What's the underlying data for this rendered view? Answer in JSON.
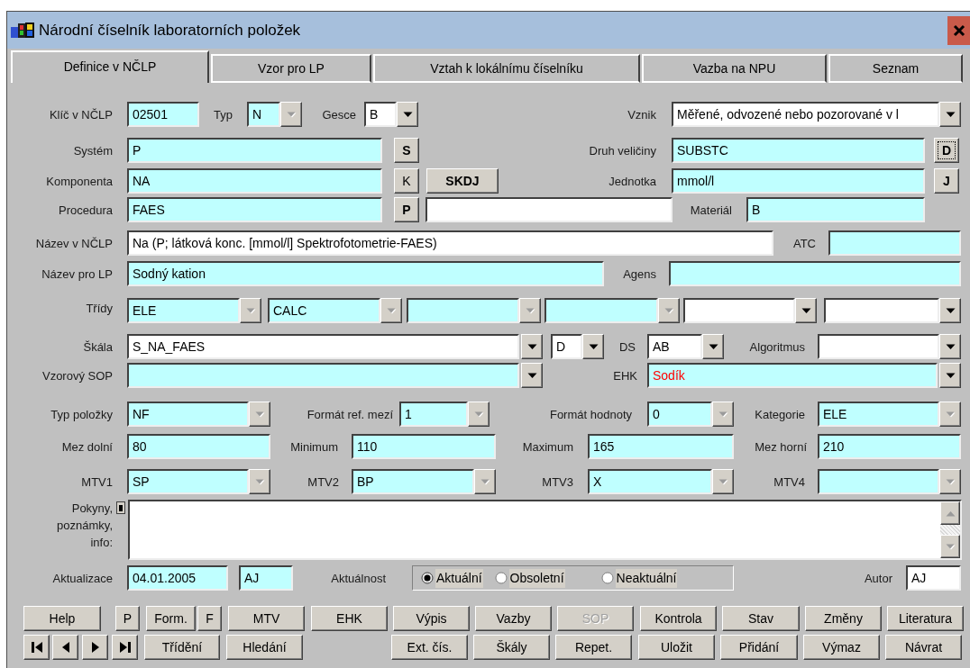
{
  "window": {
    "title": "Národní číselník laboratorních položek"
  },
  "tabs": [
    {
      "label": "Definice v NČLP",
      "selected": true
    },
    {
      "label": "Vzor pro LP",
      "selected": false
    },
    {
      "label": "Vztah k lokálnímu číselníku",
      "selected": false
    },
    {
      "label": "Vazba na NPU",
      "selected": false
    },
    {
      "label": "Seznam",
      "selected": false
    }
  ],
  "form": {
    "klic": {
      "label": "Klíč v NČLP",
      "value": "02501",
      "color": "#bfffff"
    },
    "typ": {
      "label": "Typ",
      "value": "N",
      "color": "#bfffff",
      "disabled": true
    },
    "gesce": {
      "label": "Gesce",
      "value": "B",
      "color": "#ffffff",
      "disabled": false
    },
    "vznik": {
      "label": "Vznik",
      "value": "Měřené, odvozené nebo pozorované v l",
      "color": "#ffffff",
      "disabled": false
    },
    "system": {
      "label": "Systém",
      "value": "P",
      "color": "#bfffff"
    },
    "druh": {
      "label": "Druh veličiny",
      "value": "SUBSTC",
      "color": "#bfffff"
    },
    "komponenta": {
      "label": "Komponenta",
      "value": "NA",
      "color": "#bfffff"
    },
    "jednotka": {
      "label": "Jednotka",
      "value": "mmol/l",
      "color": "#bfffff"
    },
    "procedura": {
      "label": "Procedura",
      "value": "FAES",
      "color": "#bfffff"
    },
    "procedura_text": {
      "color": "#ffffff"
    },
    "material": {
      "label": "Materiál",
      "value": "B",
      "color": "#bfffff"
    },
    "nazev_nclp": {
      "label": "Název v NČLP",
      "value": "Na (P; látková konc. [mmol/l] Spektrofotometrie-FAES)",
      "color": "#ffffff"
    },
    "atc": {
      "label": "ATC",
      "color": "#bfffff"
    },
    "nazev_lp": {
      "label": "Název pro LP",
      "value": "Sodný kation",
      "color": "#bfffff"
    },
    "agens": {
      "label": "Agens",
      "color": "#bfffff"
    },
    "tridy": {
      "label": "Třídy",
      "items": [
        {
          "value": "ELE",
          "color": "#bfffff",
          "disabled": true
        },
        {
          "value": "CALC",
          "color": "#bfffff",
          "disabled": true
        },
        {
          "color": "#bfffff",
          "disabled": true
        },
        {
          "color": "#bfffff",
          "disabled": true
        },
        {
          "color": "#ffffff",
          "disabled": false
        },
        {
          "color": "#ffffff",
          "disabled": false
        }
      ]
    },
    "skala": {
      "label": "Škála",
      "value": "S_NA_FAES",
      "color": "#ffffff",
      "disabled": false
    },
    "skala_typ": {
      "value": "D",
      "color": "#ffffff",
      "disabled": false
    },
    "ds": {
      "label": "DS",
      "value": "AB",
      "color": "#ffffff",
      "disabled": false
    },
    "algoritmus": {
      "label": "Algoritmus",
      "color": "#ffffff",
      "disabled": false
    },
    "vzorovy_sop": {
      "label": "Vzorový SOP",
      "color": "#bfffff",
      "disabled": false
    },
    "ehk": {
      "label": "EHK",
      "value": "Sodík",
      "color": "#bfffff",
      "disabled": false,
      "warning": true
    },
    "typ_polozky": {
      "label": "Typ položky",
      "value": "NF",
      "color": "#bfffff",
      "disabled": true
    },
    "format_ref": {
      "label": "Formát ref. mezí",
      "value": "1",
      "color": "#bfffff",
      "disabled": true
    },
    "format_hodnoty": {
      "label": "Formát hodnoty",
      "value": "0",
      "color": "#bfffff",
      "disabled": true
    },
    "kategorie": {
      "label": "Kategorie",
      "value": "ELE",
      "color": "#bfffff",
      "disabled": true
    },
    "mez_dolni": {
      "label": "Mez dolní",
      "value": "80",
      "color": "#bfffff"
    },
    "minimum": {
      "label": "Minimum",
      "value": "110",
      "color": "#bfffff"
    },
    "maximum": {
      "label": "Maximum",
      "value": "165",
      "color": "#bfffff"
    },
    "mez_horni": {
      "label": "Mez horní",
      "value": "210",
      "color": "#bfffff"
    },
    "mtv1": {
      "label": "MTV1",
      "value": "SP",
      "color": "#bfffff",
      "disabled": true
    },
    "mtv2": {
      "label": "MTV2",
      "value": "BP",
      "color": "#bfffff",
      "disabled": true
    },
    "mtv3": {
      "label": "MTV3",
      "value": "X",
      "color": "#bfffff",
      "disabled": true
    },
    "mtv4": {
      "label": "MTV4",
      "color": "#bfffff",
      "disabled": true
    },
    "pokyny": {
      "label": "Pokyny, poznámky, info:",
      "color": "#ffffff"
    },
    "aktualizace": {
      "label": "Aktualizace",
      "value": "04.01.2005",
      "color": "#bfffff"
    },
    "aktualizoval": {
      "value": "AJ",
      "color": "#bfffff"
    },
    "aktualnost": {
      "label": "Aktuálnost",
      "options": [
        {
          "label": "Aktuální",
          "selected": true
        },
        {
          "label": "Obsoletní",
          "selected": false
        },
        {
          "label": "Neaktuální",
          "selected": false
        }
      ]
    },
    "autor": {
      "label": "Autor",
      "value": "AJ",
      "color": "#ffffff"
    }
  },
  "side_buttons": [
    {
      "label": "S",
      "bold": true,
      "focused": false
    },
    {
      "label": "K",
      "bold": false,
      "focused": false
    },
    {
      "label": "SKDJ",
      "bold": true,
      "focused": false
    },
    {
      "label": "P",
      "bold": true,
      "focused": false
    },
    {
      "label": "D",
      "bold": true,
      "focused": true
    },
    {
      "label": "J",
      "bold": true,
      "focused": false
    }
  ],
  "buttons_row1": [
    {
      "label": "Help",
      "disabled": false
    },
    {
      "label": "P",
      "disabled": false
    },
    {
      "label": "Form.",
      "disabled": false
    },
    {
      "label": "F",
      "disabled": false
    },
    {
      "label": "MTV",
      "disabled": false
    },
    {
      "label": "EHK",
      "disabled": false
    },
    {
      "label": "Výpis",
      "disabled": false
    },
    {
      "label": "Vazby",
      "disabled": false
    },
    {
      "label": "SOP",
      "disabled": true
    },
    {
      "label": "Kontrola",
      "disabled": false
    },
    {
      "label": "Stav",
      "disabled": false
    },
    {
      "label": "Změny",
      "disabled": false
    },
    {
      "label": "Literatura",
      "disabled": false
    }
  ],
  "nav_buttons": [
    {
      "kind": "first"
    },
    {
      "kind": "prev"
    },
    {
      "kind": "next"
    },
    {
      "kind": "last"
    }
  ],
  "buttons_row2": [
    {
      "label": "Třídění",
      "disabled": false
    },
    {
      "label": "Hledání",
      "disabled": false
    },
    {
      "label": "Ext. čís.",
      "disabled": false
    },
    {
      "label": "Škály",
      "disabled": false
    },
    {
      "label": "Repet.",
      "disabled": false
    },
    {
      "label": "Uložit",
      "disabled": false
    },
    {
      "label": "Přidání",
      "disabled": false
    },
    {
      "label": "Výmaz",
      "disabled": false
    },
    {
      "label": "Návrat",
      "disabled": false
    }
  ]
}
